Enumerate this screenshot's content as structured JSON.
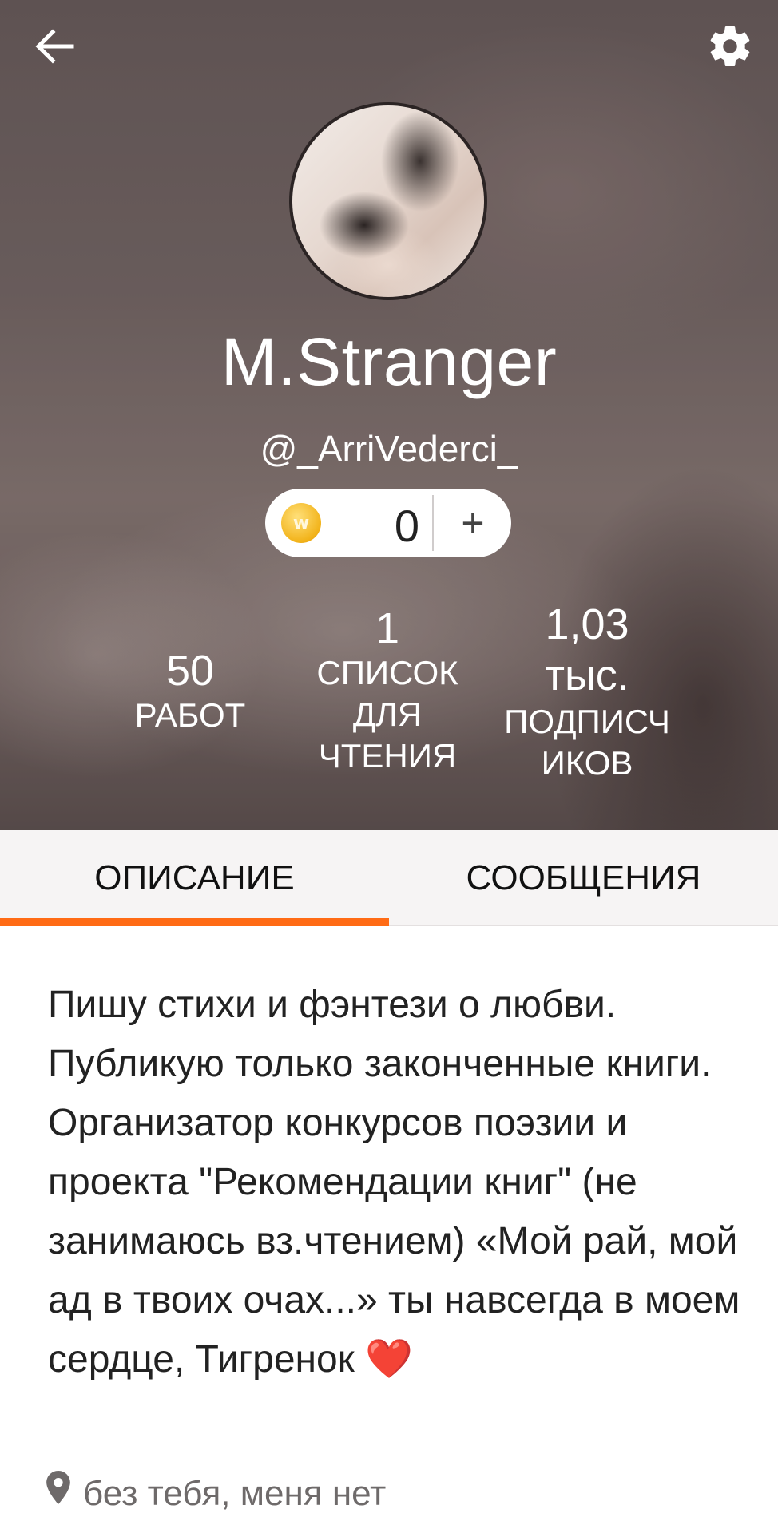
{
  "header": {
    "display_name": "M.Stranger",
    "username": "@_ArriVederci_",
    "coins": {
      "icon": "coin-icon",
      "value": "0",
      "add_label": "+"
    },
    "stats": [
      {
        "value": "50",
        "label": "РАБОТ"
      },
      {
        "value": "1",
        "label": "СПИСОК\nДЛЯ\nЧТЕНИЯ"
      },
      {
        "value": "1,03\nтыс.",
        "label": "ПОДПИСЧ\nИКОВ"
      }
    ]
  },
  "toolbar": {
    "back_icon": "arrow-left-icon",
    "settings_icon": "gear-icon"
  },
  "tabs": [
    {
      "label": "ОПИСАНИЕ",
      "active": true
    },
    {
      "label": "СООБЩЕНИЯ",
      "active": false
    }
  ],
  "bio": {
    "text": "Пишу стихи и фэнтези о любви. Публикую только законченные книги. Организатор конкурсов поэзии и проекта \"Рекомендации книг\" (не занимаюсь вз.чтением) «Мой рай, мой ад в твоих очах...» ты навсегда в моем сердце, Тигренок",
    "emoji": "❤️",
    "location": "без тебя, меня нет"
  },
  "colors": {
    "accent": "#ff6b15",
    "tab_bg": "#f6f4f4"
  }
}
